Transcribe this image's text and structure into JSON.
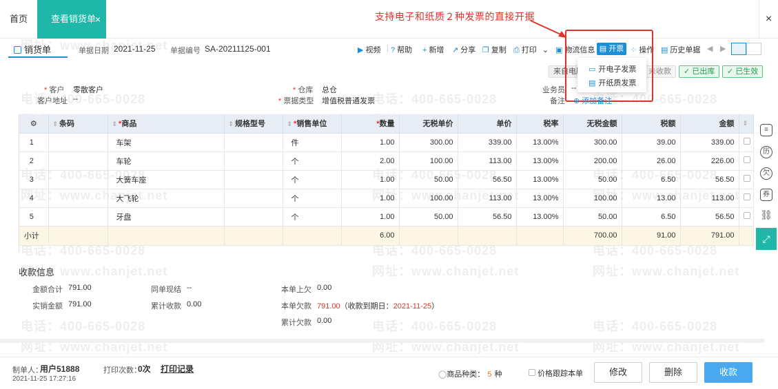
{
  "tabs": {
    "home": "首页",
    "active": "查看销货单",
    "close": "×"
  },
  "window_close": "×",
  "annotation": {
    "callout": "支持电子和纸质２种发票的直接开据"
  },
  "doc": {
    "title": "销货单",
    "date_label": "单据日期",
    "date": "2021-11-25",
    "no_label": "单据编号",
    "no": "SA-20211125-001"
  },
  "toolbar": {
    "video": "视频",
    "help": "帮助",
    "new": "新增",
    "share": "分享",
    "copy": "复制",
    "print": "打印",
    "logistics": "物流信息",
    "invoice": "开票",
    "ops": "操作",
    "history": "历史单据"
  },
  "dropdown": {
    "e_invoice": "开电子发票",
    "paper_invoice": "开纸质发票"
  },
  "status": {
    "from": "来自电脑",
    "unpaid": "未收款",
    "out": "已出库",
    "effective": "已生效"
  },
  "form": {
    "customer_label": "客户",
    "customer": "零散客户",
    "address_label": "客户地址",
    "address": "--",
    "warehouse_label": "仓库",
    "warehouse": "总仓",
    "invoice_type_label": "票据类型",
    "invoice_type": "增值税普通发票",
    "salesman_label": "业务员",
    "salesman": "--",
    "remark_label": "备注",
    "remark_add": "添加备注"
  },
  "table": {
    "headers": [
      "条码",
      "商品",
      "规格型号",
      "销售单位",
      "数量",
      "无税单价",
      "单价",
      "税率",
      "无税金额",
      "税额",
      "金额"
    ],
    "rows": [
      [
        "1",
        "",
        "车架",
        "",
        "件",
        "1.00",
        "300.00",
        "339.00",
        "13.00%",
        "300.00",
        "39.00",
        "339.00"
      ],
      [
        "2",
        "",
        "车轮",
        "",
        "个",
        "2.00",
        "100.00",
        "113.00",
        "13.00%",
        "200.00",
        "26.00",
        "226.00"
      ],
      [
        "3",
        "",
        "大簧车座",
        "",
        "个",
        "1.00",
        "50.00",
        "56.50",
        "13.00%",
        "50.00",
        "6.50",
        "56.50"
      ],
      [
        "4",
        "",
        "大飞轮",
        "",
        "个",
        "1.00",
        "100.00",
        "113.00",
        "13.00%",
        "100.00",
        "13.00",
        "113.00"
      ],
      [
        "5",
        "",
        "牙盘",
        "",
        "个",
        "1.00",
        "50.00",
        "56.50",
        "13.00%",
        "50.00",
        "6.50",
        "56.50"
      ]
    ],
    "subtotal": {
      "label": "小计",
      "qty": "6.00",
      "notax": "700.00",
      "tax": "91.00",
      "amount": "791.00"
    }
  },
  "payment": {
    "title": "收款信息",
    "total_label": "金额合计",
    "total": "791.00",
    "actual_label": "实销金额",
    "actual": "791.00",
    "same_label": "同单现结",
    "same": "--",
    "cum_recv_label": "累计收款",
    "cum_recv": "0.00",
    "prev_owe_label": "本单上欠",
    "prev_owe": "0.00",
    "owe_label": "本单欠款",
    "owe": "791.00",
    "owe_note_pre": "（收款到期日：",
    "owe_date": "2021-11-25",
    "owe_note_post": "）",
    "cum_owe_label": "累计欠款",
    "cum_owe": "0.00"
  },
  "footer": {
    "maker_label": "制单人：",
    "maker": "用户51888",
    "print_label": "打印次数：",
    "print_count": "0次",
    "print_log": "打印记录",
    "timestamp": "2021-11-25 17:27:16",
    "kinds_label": "商品种类：",
    "kinds": "5",
    "kinds_unit": "种",
    "price_follow": "价格跟踪本单",
    "edit": "修改",
    "delete": "删除",
    "collect": "收款"
  },
  "watermark": {
    "phone": "电话：400-665-0028",
    "site": "网址：www.chanjet.net"
  },
  "colors": {
    "teal": "#1fb7a8",
    "blue": "#1a8fd6",
    "red": "#e0322b",
    "green": "#1d9b4a"
  }
}
